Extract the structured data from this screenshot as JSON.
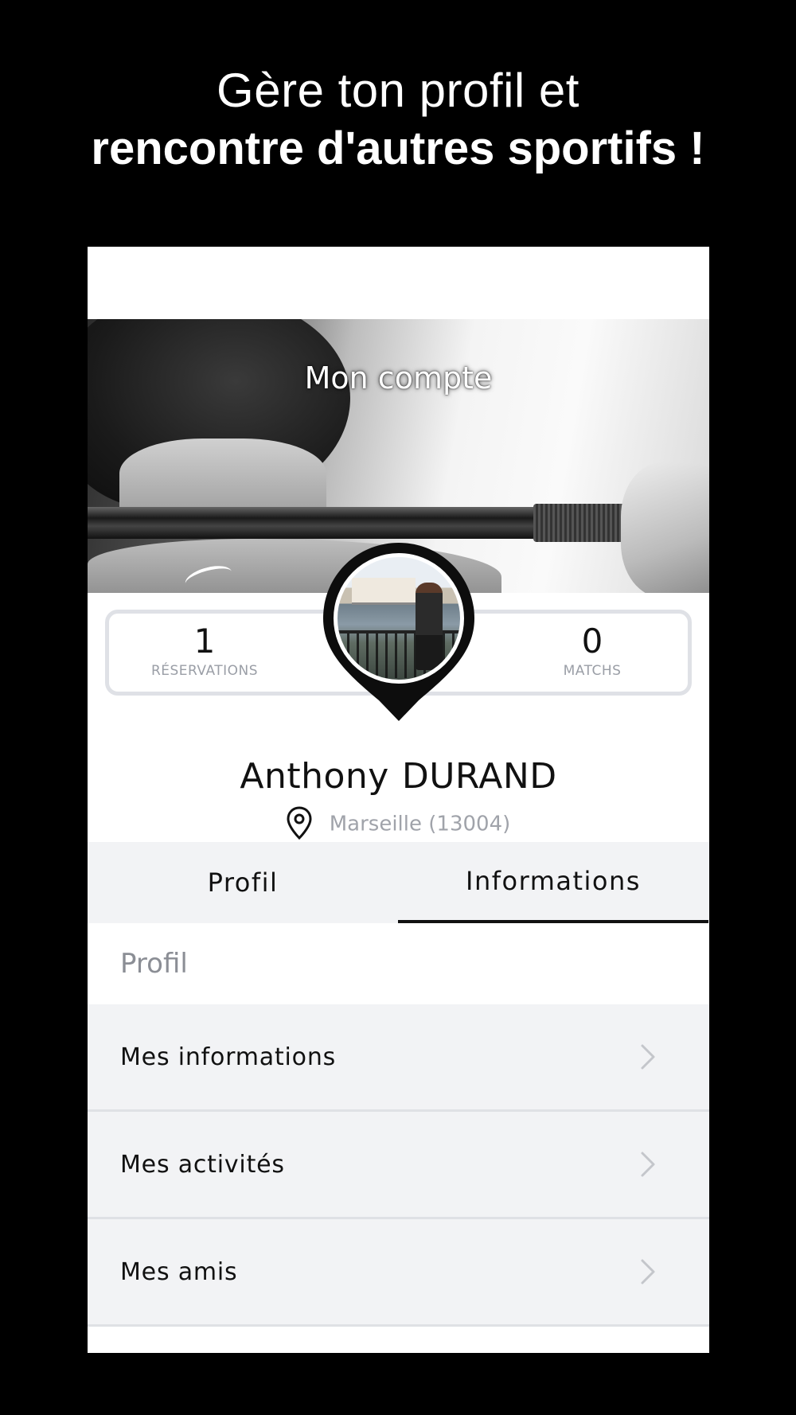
{
  "promo": {
    "line1": "Gère ton profil et",
    "line2": "rencontre d'autres sportifs !"
  },
  "header": {
    "title": "Mon compte"
  },
  "stats": {
    "reservations": {
      "value": "1",
      "label": "RÉSERVATIONS"
    },
    "matchs": {
      "value": "0",
      "label": "MATCHS"
    }
  },
  "user": {
    "first_name": "Anthony",
    "last_name": "DURAND",
    "location": "Marseille (13004)"
  },
  "tabs": [
    {
      "label": "Profil",
      "active": false
    },
    {
      "label": "Informations",
      "active": true
    }
  ],
  "section": {
    "title": "Profil"
  },
  "menu": [
    {
      "label": "Mes informations",
      "icon": "chevron-right-icon"
    },
    {
      "label": "Mes activités",
      "icon": "chevron-right-icon"
    },
    {
      "label": "Mes amis",
      "icon": "chevron-right-icon"
    }
  ],
  "colors": {
    "background": "#000000",
    "accent": "#111111",
    "muted_text": "#9a9ea6",
    "row_background": "#f2f3f5",
    "card_border": "#dfe1e6"
  }
}
